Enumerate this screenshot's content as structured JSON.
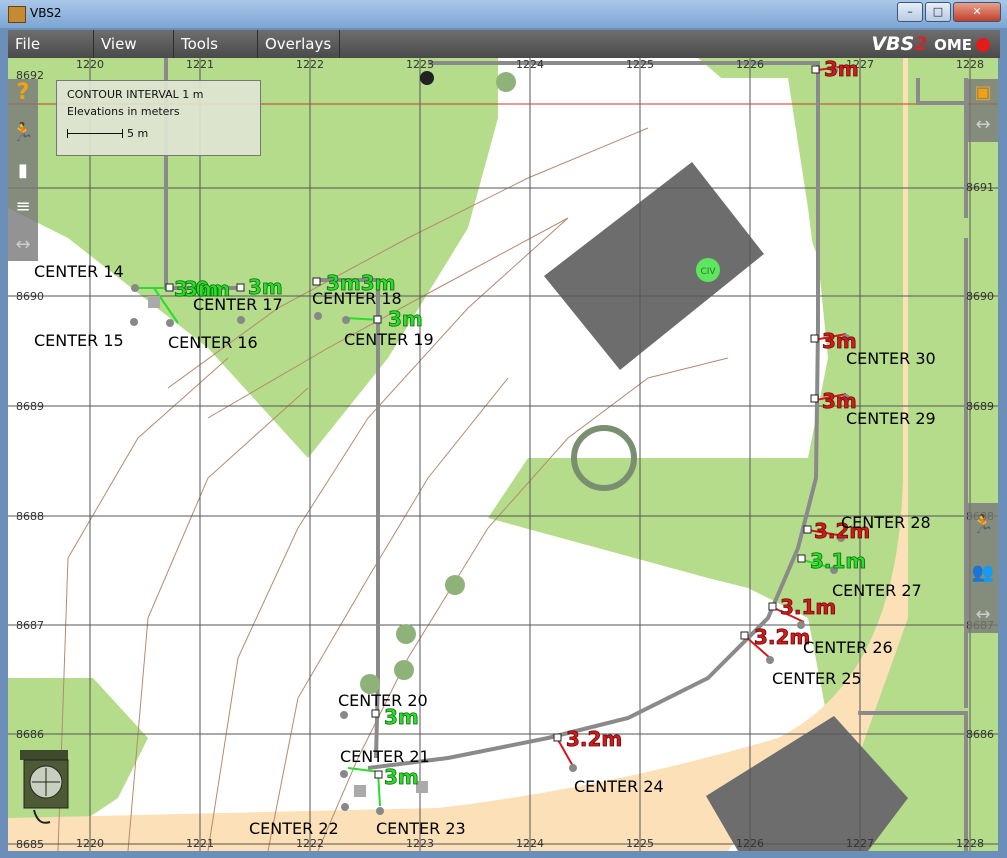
{
  "window": {
    "title": "VBS2",
    "btn_min": "–",
    "btn_max": "□",
    "btn_close": "✕"
  },
  "menu": [
    {
      "label": "File"
    },
    {
      "label": "View"
    },
    {
      "label": "Tools"
    },
    {
      "label": "Overlays"
    }
  ],
  "logo": {
    "brand": "VBS",
    "two": "2",
    "suffix": "OME"
  },
  "legend": {
    "line1": "CONTOUR INTERVAL 1 m",
    "line2": "Elevations in meters",
    "scale": "5 m"
  },
  "grid": {
    "x_labels_top": [
      "1220",
      "1221",
      "1222",
      "1223",
      "1224",
      "1225",
      "1226",
      "1227",
      "1228"
    ],
    "x_labels_bottom": [
      "1220",
      "1221",
      "1222",
      "1223",
      "1224",
      "1225",
      "1226",
      "1227",
      "1228"
    ],
    "y_labels": [
      "8692",
      "8691",
      "8690",
      "8689",
      "8688",
      "8687",
      "8686",
      "8685"
    ]
  },
  "map_marker": {
    "civ_label": "CIV"
  },
  "center_labels": [
    "CENTER 14",
    "CENTER 15",
    "CENTER 16",
    "CENTER 17",
    "CENTER 18",
    "CENTER 19",
    "CENTER 20",
    "CENTER 21",
    "CENTER 22",
    "CENTER 23",
    "CENTER 24",
    "CENTER 25",
    "CENTER 26",
    "CENTER 27",
    "CENTER 28",
    "CENTER 29",
    "CENTER 30"
  ],
  "measure_green": [
    "3.0m",
    "3m",
    "3m",
    "3m3m",
    "3m",
    "3m",
    "3m",
    "3.1m"
  ],
  "measure_red": [
    "3m",
    "3m",
    "3m",
    "3.2m",
    "3.1m",
    "3.2m",
    "3.2m"
  ],
  "colors": {
    "green_area": "#b5dc8a",
    "road": "#fbe0b8",
    "building": "#6d6d6d",
    "grid": "#555555",
    "contour": "#b58a6e",
    "measure_green": "#2bdd2b",
    "measure_red": "#d11a1a"
  },
  "icons": {
    "help": "question-icon",
    "unit": "soldier-icon",
    "layer1": "layer-icon",
    "layer2": "layers-icon",
    "arrows": "expand-arrows-icon",
    "group": "group-icon"
  }
}
